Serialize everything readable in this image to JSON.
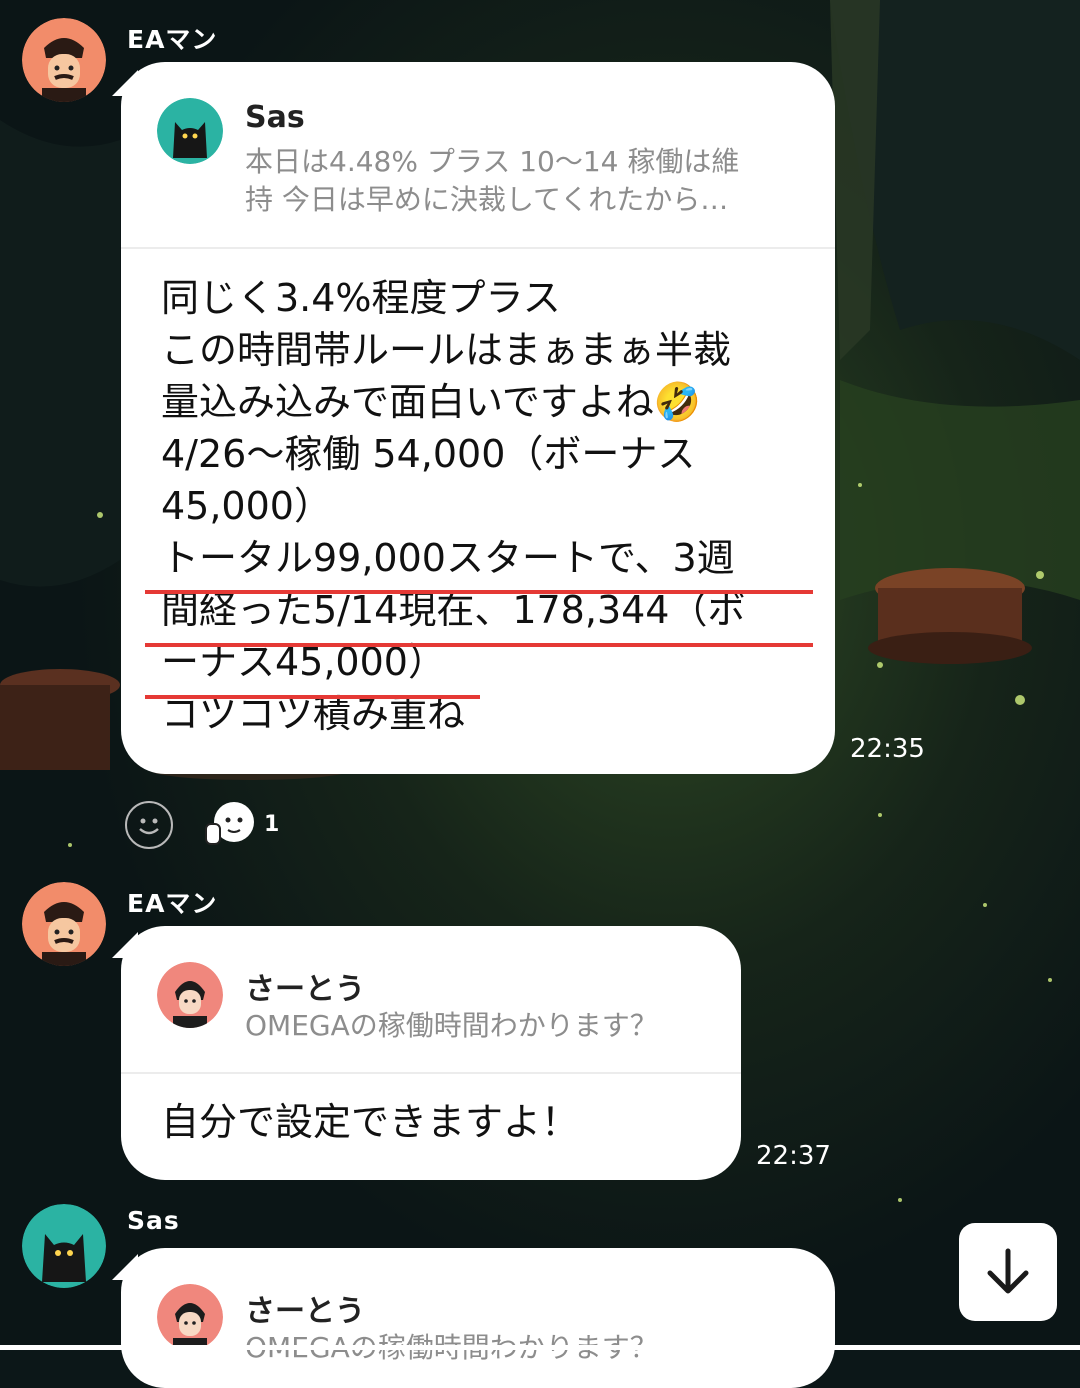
{
  "messages": [
    {
      "sender": "EAマン",
      "quote": {
        "name": "Sas",
        "text_lines": [
          "本日は4.48% プラス 10～14 稼働は維",
          "持 今日は早めに決裁してくれたから…"
        ]
      },
      "body_lines": [
        "同じく3.4%程度プラス",
        "この時間帯ルールはまぁまぁ半裁",
        "量込み込みで面白いですよね",
        "4/26～稼働 54,000（ボーナス",
        " 45,000）",
        "トータル99,000スタートで、3週",
        "間経った5/14現在、178,344（ボ",
        "ーナス45,000）",
        "コツコツ積み重ね"
      ],
      "emoji": "🤣",
      "time": "22:35",
      "reaction": {
        "icon": "smiley-add-icon",
        "sticker": "thumbs-up-sticker-icon",
        "count": "1"
      }
    },
    {
      "sender": "EAマン",
      "quote": {
        "name": "さーとう",
        "text_lines": [
          "OMEGAの稼働時間わかります？"
        ]
      },
      "body_lines": [
        "自分で設定できますよ！"
      ],
      "time": "22:37"
    },
    {
      "sender": "Sas",
      "quote": {
        "name": "さーとう",
        "text_lines": [
          "OMEGAの稼働時間わかります？"
        ]
      }
    }
  ],
  "scroll_button": {
    "icon": "arrow-down-icon"
  },
  "colors": {
    "highlight": "#e53935",
    "bubble": "#ffffff",
    "background": "#0c1718"
  }
}
